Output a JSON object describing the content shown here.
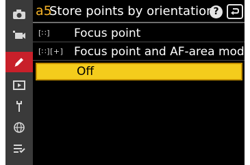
{
  "header": {
    "code": "a5",
    "title": "Store points by orientation",
    "help_label": "?"
  },
  "tabs": [
    {
      "name": "photo-shooting-menu",
      "icon": "camera-icon"
    },
    {
      "name": "movie-recording-menu",
      "icon": "movie-camera-icon"
    },
    {
      "name": "custom-settings-menu",
      "icon": "pencil-icon",
      "active": true
    },
    {
      "name": "playback-menu",
      "icon": "playback-icon"
    },
    {
      "name": "setup-menu",
      "icon": "wrench-icon"
    },
    {
      "name": "network-menu",
      "icon": "network-icon"
    },
    {
      "name": "my-menu",
      "icon": "my-menu-icon"
    }
  ],
  "options": [
    {
      "icon_text": "[∷]",
      "label": "Focus point"
    },
    {
      "icon_text": "[∷][+]",
      "label": "Focus point and AF-area mode"
    },
    {
      "icon_text": "",
      "label": "Off",
      "selected": true
    }
  ],
  "colors": {
    "highlight": "#f4cc1c",
    "active_tab": "#c8202a",
    "code": "#f4b228"
  }
}
